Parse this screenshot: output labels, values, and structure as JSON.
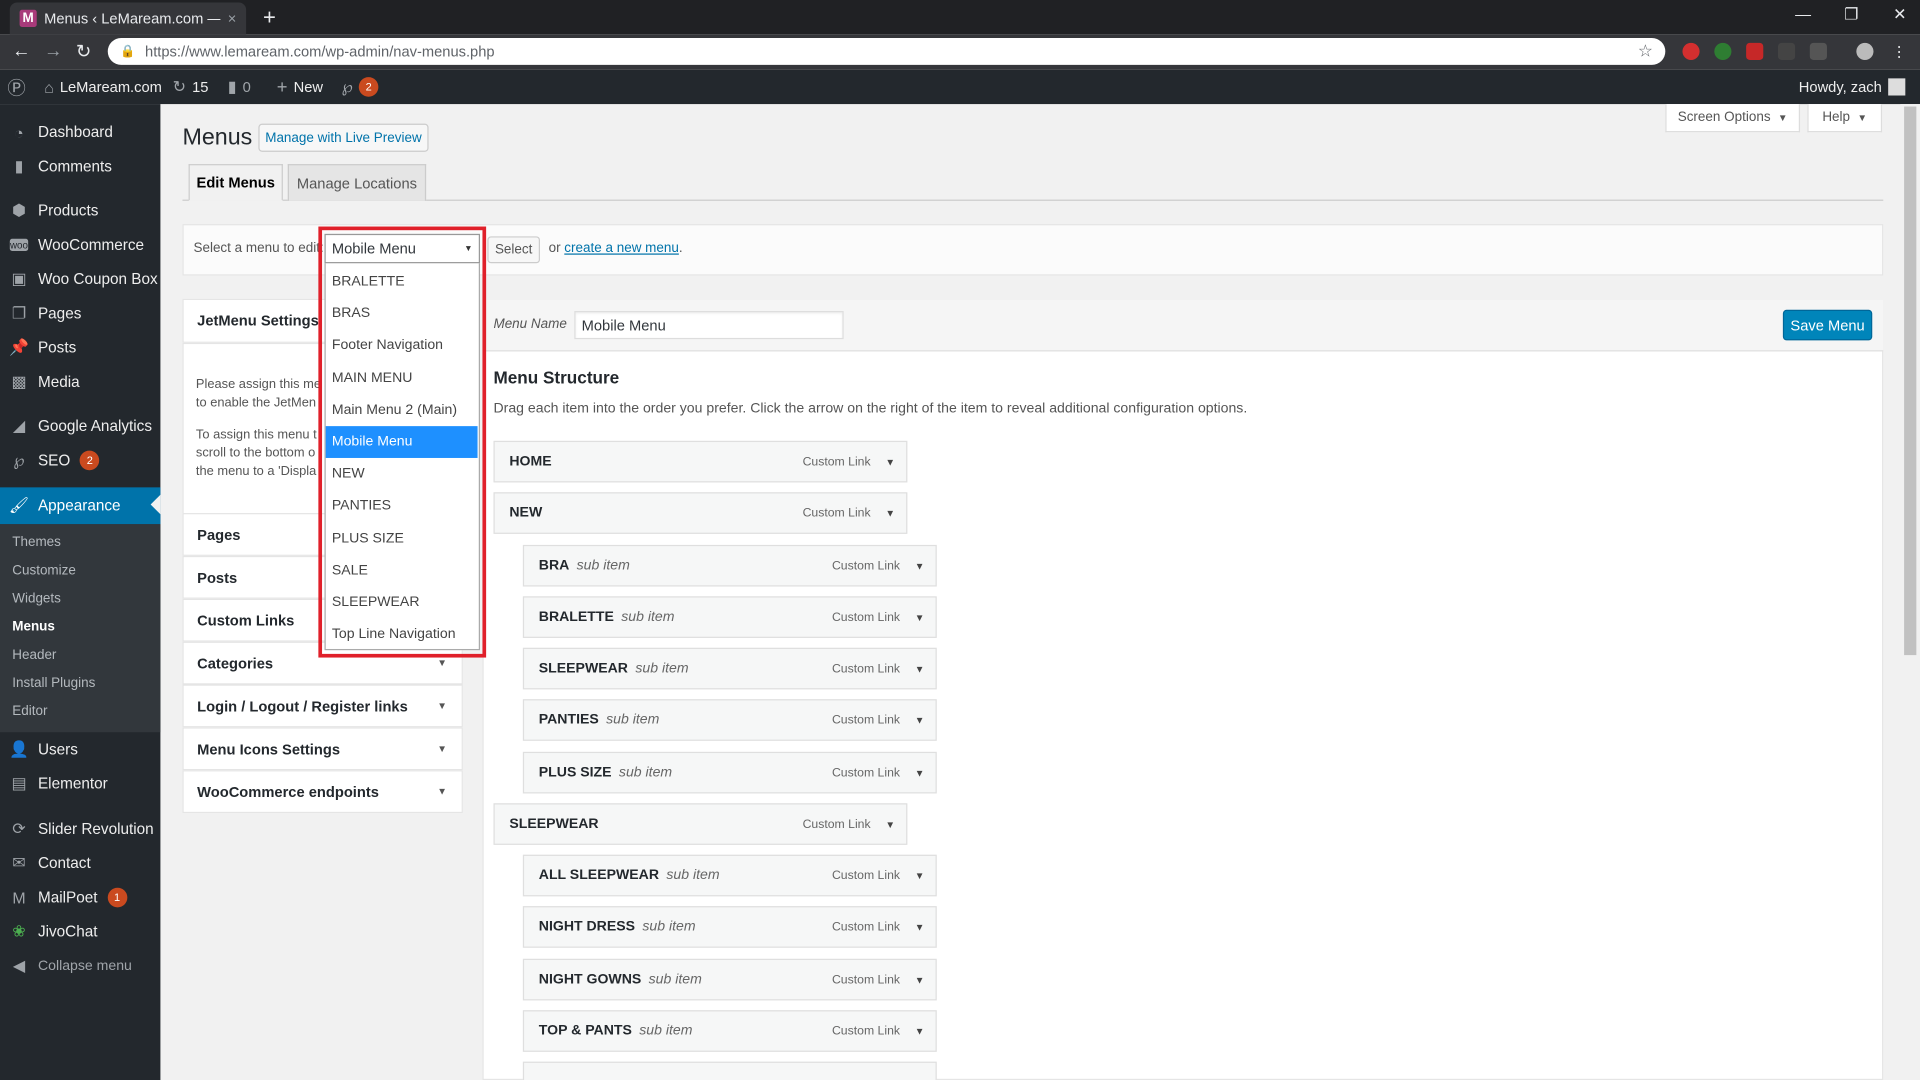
{
  "browser": {
    "tab_title": "Menus ‹ LeMaream.com — Word",
    "tab_close": "×",
    "new_tab": "+",
    "url": "https://www.lemaream.com/wp-admin/nav-menus.php"
  },
  "adminbar": {
    "site_name": "LeMaream.com",
    "updates_count": "15",
    "comments_count": "0",
    "new_label": "New",
    "yoast_count": "2",
    "howdy": "Howdy, zach"
  },
  "sidebar": {
    "items": [
      {
        "label": "Dashboard",
        "icon": "dashboard-icon"
      },
      {
        "label": "Comments",
        "icon": "comments-icon"
      },
      {
        "label": "Products",
        "icon": "products-icon"
      },
      {
        "label": "WooCommerce",
        "icon": "woocommerce-icon"
      },
      {
        "label": "Woo Coupon Box",
        "icon": "coupon-icon"
      },
      {
        "label": "Pages",
        "icon": "pages-icon"
      },
      {
        "label": "Posts",
        "icon": "posts-icon"
      },
      {
        "label": "Media",
        "icon": "media-icon"
      },
      {
        "label": "Google Analytics",
        "icon": "analytics-icon"
      },
      {
        "label": "SEO",
        "icon": "seo-icon",
        "badge": "2"
      },
      {
        "label": "Appearance",
        "icon": "appearance-icon"
      },
      {
        "label": "Users",
        "icon": "users-icon"
      },
      {
        "label": "Elementor",
        "icon": "elementor-icon"
      },
      {
        "label": "Slider Revolution",
        "icon": "slider-icon"
      },
      {
        "label": "Contact",
        "icon": "contact-icon"
      },
      {
        "label": "MailPoet",
        "icon": "mailpoet-icon",
        "badge": "1"
      },
      {
        "label": "JivoChat",
        "icon": "jivochat-icon"
      },
      {
        "label": "Collapse menu",
        "icon": "collapse-icon"
      }
    ],
    "submenu": [
      "Themes",
      "Customize",
      "Widgets",
      "Menus",
      "Header",
      "Install Plugins",
      "Editor"
    ]
  },
  "page": {
    "title": "Menus",
    "live_preview": "Manage with Live Preview",
    "screen_options": "Screen Options",
    "help": "Help",
    "tab_edit": "Edit Menus",
    "tab_locations": "Manage Locations",
    "select_label": "Select a menu to edit:",
    "select_button": "Select",
    "or_text": "or",
    "create_link": "create a new menu",
    "period": "."
  },
  "dropdown": {
    "selected": "Mobile Menu",
    "options": [
      "BRALETTE",
      "BRAS",
      "Footer Navigation",
      "MAIN MENU",
      "Main Menu 2 (Main)",
      "Mobile Menu",
      "NEW",
      "PANTIES",
      "PLUS SIZE",
      "SALE",
      "SLEEPWEAR",
      "Top Line Navigation"
    ],
    "selected_index": 5
  },
  "left_panel": {
    "jetmenu_title": "JetMenu Settings",
    "jetmenu_text1a": "Please assign this me",
    "jetmenu_text1b": "to enable the JetMen",
    "jetmenu_text2a": "To assign this menu t",
    "jetmenu_text2b": "scroll to the bottom o",
    "jetmenu_text2c": "the menu to a 'Displa",
    "sections": [
      "Pages",
      "Posts",
      "Custom Links",
      "Categories",
      "Login / Logout / Register links",
      "Menu Icons Settings",
      "WooCommerce endpoints"
    ]
  },
  "editor": {
    "menu_name_label": "Menu Name",
    "menu_name_value": "Mobile Menu",
    "save_button": "Save Menu",
    "structure_title": "Menu Structure",
    "structure_desc": "Drag each item into the order you prefer. Click the arrow on the right of the item to reveal additional configuration options.",
    "items": [
      {
        "title": "HOME",
        "sub": "",
        "type": "Custom Link",
        "depth": 0
      },
      {
        "title": "NEW",
        "sub": "",
        "type": "Custom Link",
        "depth": 0
      },
      {
        "title": "BRA",
        "sub": "sub item",
        "type": "Custom Link",
        "depth": 1
      },
      {
        "title": "BRALETTE",
        "sub": "sub item",
        "type": "Custom Link",
        "depth": 1
      },
      {
        "title": "SLEEPWEAR",
        "sub": "sub item",
        "type": "Custom Link",
        "depth": 1
      },
      {
        "title": "PANTIES",
        "sub": "sub item",
        "type": "Custom Link",
        "depth": 1
      },
      {
        "title": "PLUS SIZE",
        "sub": "sub item",
        "type": "Custom Link",
        "depth": 1
      },
      {
        "title": "SLEEPWEAR",
        "sub": "",
        "type": "Custom Link",
        "depth": 0
      },
      {
        "title": "ALL SLEEPWEAR",
        "sub": "sub item",
        "type": "Custom Link",
        "depth": 1
      },
      {
        "title": "NIGHT DRESS",
        "sub": "sub item",
        "type": "Custom Link",
        "depth": 1
      },
      {
        "title": "NIGHT GOWNS",
        "sub": "sub item",
        "type": "Custom Link",
        "depth": 1
      },
      {
        "title": "TOP & PANTS",
        "sub": "sub item",
        "type": "Custom Link",
        "depth": 1
      }
    ]
  },
  "colors": {
    "accent": "#0073aa",
    "primary_button": "#0085ba",
    "highlight_box": "#e0202a",
    "selected_option": "#1e90ff"
  }
}
